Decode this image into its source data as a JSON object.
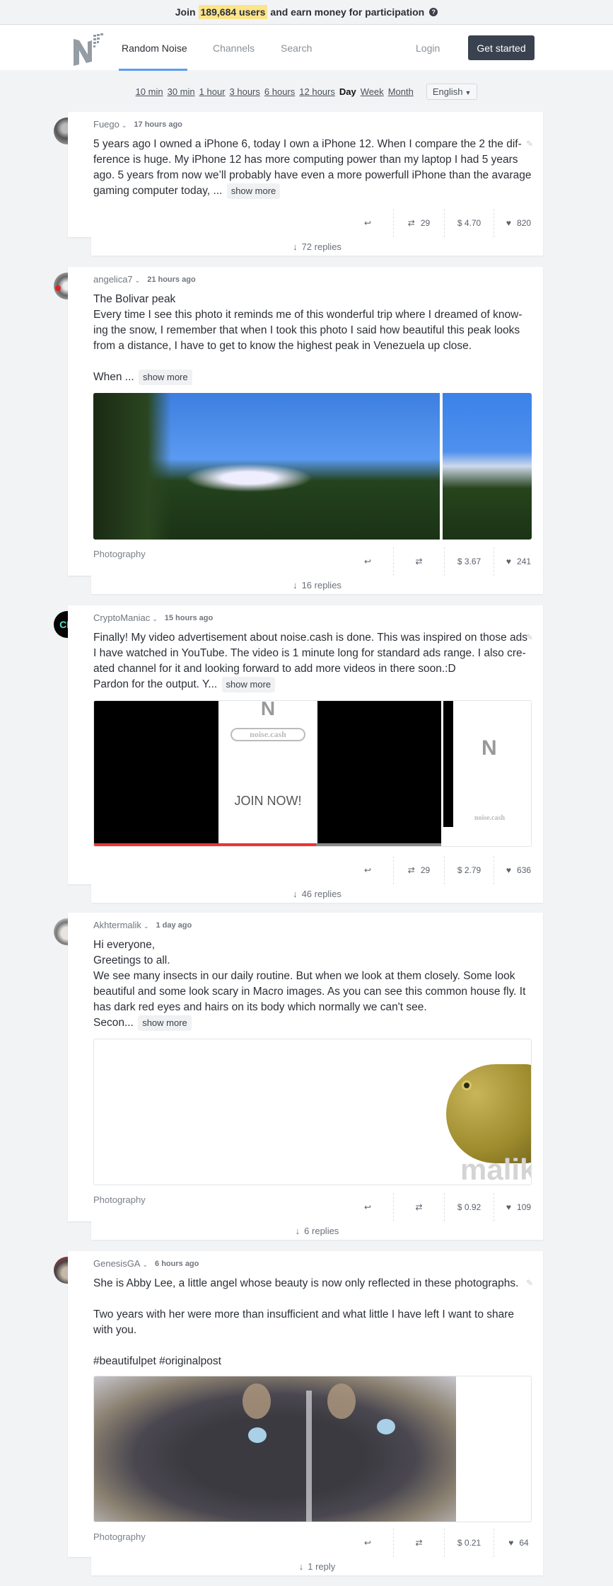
{
  "banner": {
    "prefix": "Join",
    "highlight": "189,684 users",
    "suffix": "and earn money for participation",
    "help_icon": "question-circle-icon"
  },
  "nav": {
    "logo": "noise-cash-logo",
    "links": [
      {
        "label": "Random Noise",
        "active": true
      },
      {
        "label": "Channels",
        "active": false
      },
      {
        "label": "Search",
        "active": false
      }
    ],
    "login_label": "Login",
    "get_started_label": "Get started"
  },
  "filters": {
    "periods": [
      "10 min",
      "30 min",
      "1 hour",
      "3 hours",
      "6 hours",
      "12 hours",
      "Day",
      "Week",
      "Month"
    ],
    "selected": "Day",
    "language": "English"
  },
  "colors": {
    "accent_underline": "#5b9ef0",
    "highlight": "#fce48b",
    "button_dark": "#3a4250"
  },
  "posts": [
    {
      "user": "Fuego",
      "time": "17 hours ago",
      "text": "5 years ago I owned a iPhone 6, today I own a iPhone 12. When I compare the 2 the dif­ference is huge. My iPhone 12 has more computing power than my laptop I had 5 years ago. 5 years from now we’ll probably have even a more powerfull iPhone than the avarage gaming computer today, ...",
      "show_more": "show more",
      "category": "",
      "retweets": "29",
      "tips": "$ 4.70",
      "likes": "820",
      "replies": "72 replies"
    },
    {
      "user": "angelica7",
      "time": "21 hours ago",
      "title": "The Bolivar peak",
      "text": "Every time I see this photo it reminds me of this wonderful trip where I dreamed of know­ing the snow, I remember that when I took this photo I said how beautiful this peak looks from a distance, I have to get to know the highest peak in Venezuela up close.",
      "text2": "When ...",
      "show_more": "show more",
      "media": "mountain-photo",
      "category": "Photography",
      "retweets": "",
      "tips": "$ 3.67",
      "likes": "241",
      "replies": "16 replies"
    },
    {
      "user": "CryptoManiac",
      "time": "15 hours ago",
      "text": "Finally! My video advertisement about noise.cash is done. This was inspired on those ads I have watched in YouTube. The video is 1 minute long for standard ads range. I also cre­ated channel for it and looking forward to add more videos in there soon.:D",
      "text2": "Pardon for the output. Y...",
      "show_more": "show more",
      "media": "video-advertisement",
      "video_overlay": {
        "search_text": "noise.cash",
        "cta": "JOIN NOW!",
        "watermark": "noise.cash"
      },
      "video_progress": 0.64,
      "category": "",
      "retweets": "29",
      "tips": "$ 2.79",
      "likes": "636",
      "replies": "46 replies"
    },
    {
      "user": "Akhtermalik",
      "time": "1 day ago",
      "lines": [
        "Hi everyone,",
        "Greetings to all."
      ],
      "text": "We see many insects in our daily routine. But when we look at them closely. Some look beautiful and some look scary in Macro images. As you can see this common house fly. It has dark red eyes and hairs on its body which normally we can't see.",
      "text2": "Secon...",
      "show_more": "show more",
      "media": "toad-photo",
      "media_watermark": "malik",
      "category": "Photography",
      "retweets": "",
      "tips": "$ 0.92",
      "likes": "109",
      "replies": "6 replies"
    },
    {
      "user": "GenesisGA",
      "time": "6 hours ago",
      "text": "She is Abby Lee, a little angel whose beauty is now only reflected in these photographs.",
      "text2": "Two years with her were more than insufficient and what little I have left I want to share with you.",
      "hashtags": "#beautifulpet #originalpost",
      "media": "dog-photo",
      "category": "Photography",
      "retweets": "",
      "tips": "$ 0.21",
      "likes": "64",
      "replies": "1 reply"
    }
  ]
}
